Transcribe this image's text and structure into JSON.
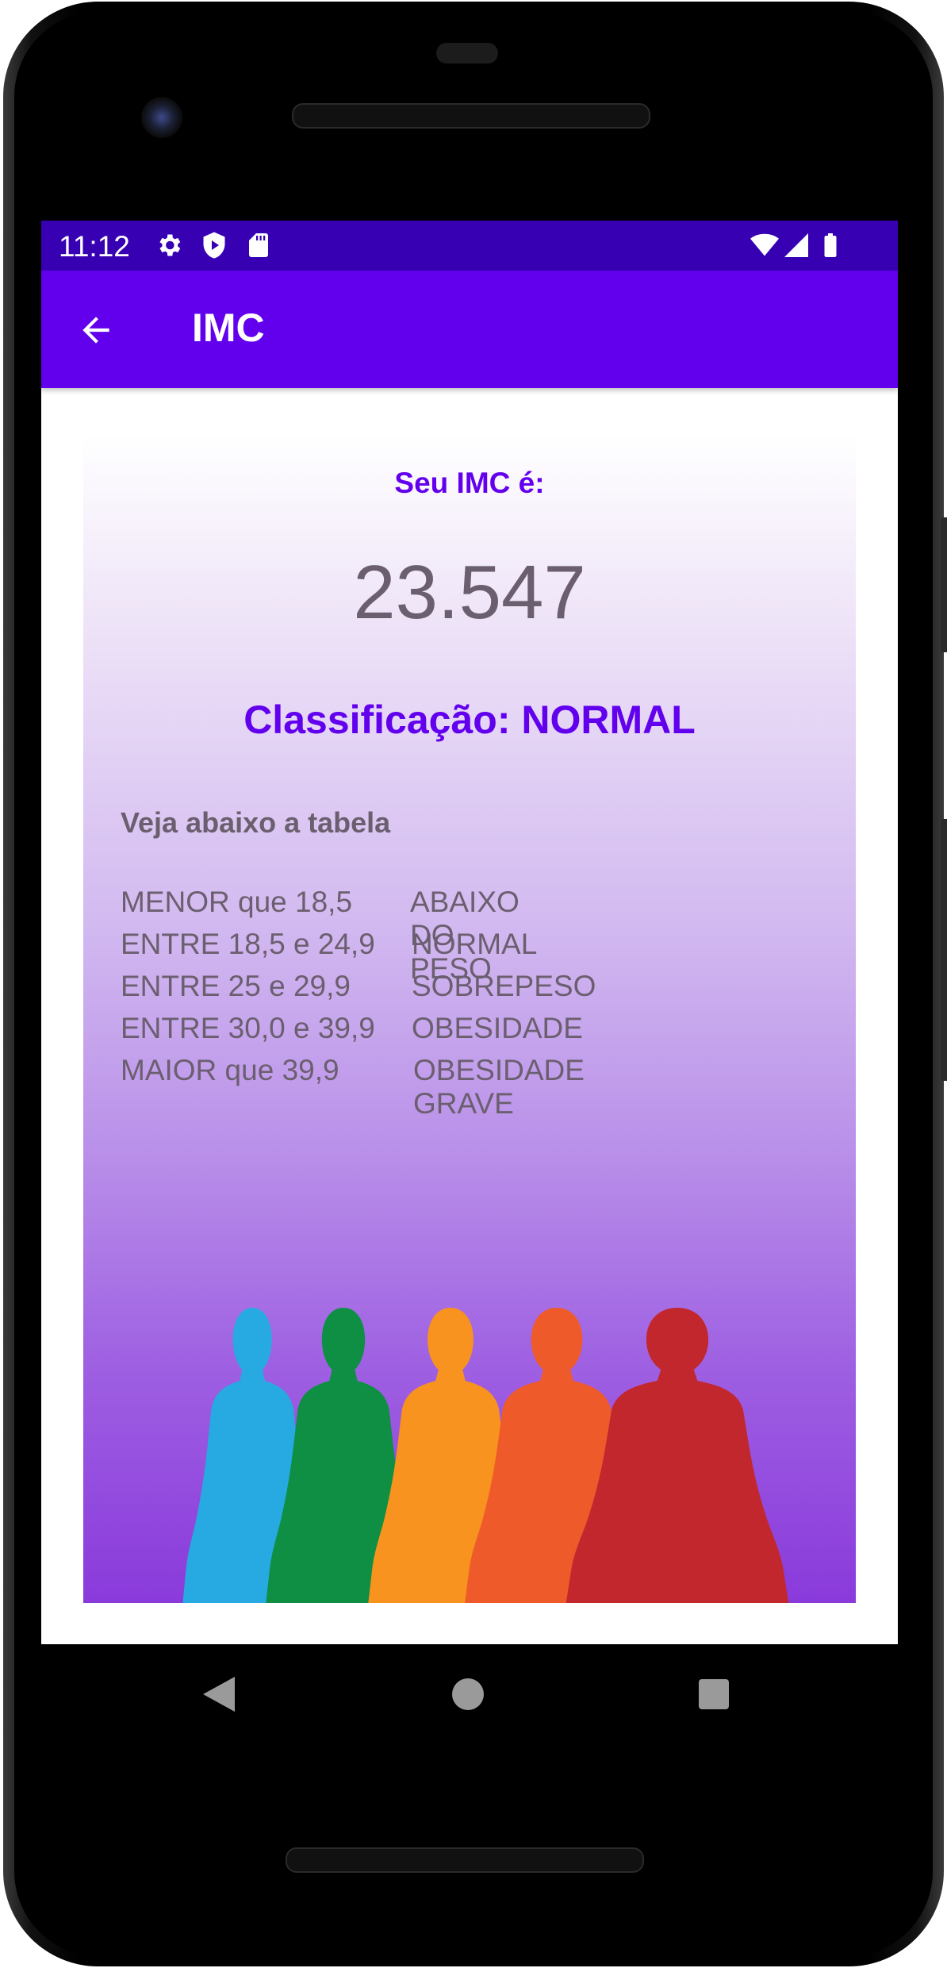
{
  "status_bar": {
    "time": "11:12",
    "left_icons": [
      "gear-icon",
      "shield-play-icon",
      "sd-card-icon"
    ],
    "right_icons": [
      "wifi-icon",
      "signal-icon",
      "battery-icon"
    ]
  },
  "app_bar": {
    "back_icon": "arrow-left-icon",
    "title": "IMC"
  },
  "result": {
    "heading": "Seu IMC é:",
    "value": "23.547",
    "classification": "Classificação: NORMAL"
  },
  "table": {
    "title": "Veja abaixo a tabela",
    "rows": [
      {
        "range": "MENOR que 18,5",
        "label": "ABAIXO DO PESO"
      },
      {
        "range": "ENTRE 18,5 e 24,9",
        "label": "NORMAL"
      },
      {
        "range": "ENTRE 25 e 29,9",
        "label": "SOBREPESO"
      },
      {
        "range": "ENTRE 30,0 e 39,9",
        "label": "OBESIDADE"
      },
      {
        "range": "MAIOR que 39,9",
        "label": "OBESIDADE GRAVE"
      }
    ]
  },
  "illustration": {
    "silhouette_colors": [
      "#27a9e1",
      "#0f8f43",
      "#f7931e",
      "#ef5a2a",
      "#c1272d"
    ]
  },
  "colors": {
    "status_bar": "#3700b3",
    "app_bar": "#6200ee",
    "accent_text": "#6200ee",
    "body_text": "#6b5f6f"
  },
  "nav_bar": {
    "icons": [
      "nav-back-icon",
      "nav-home-icon",
      "nav-recents-icon"
    ]
  }
}
